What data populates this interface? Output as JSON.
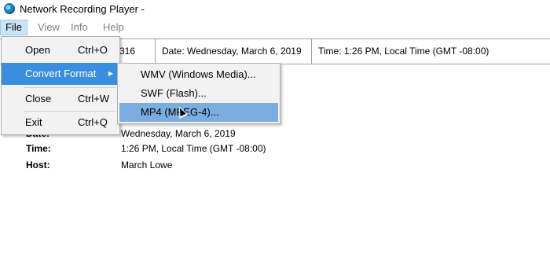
{
  "window": {
    "title": "Network Recording Player -"
  },
  "menubar": {
    "items": [
      {
        "label": "File"
      },
      {
        "label": "View"
      },
      {
        "label": "Info"
      },
      {
        "label": "Help"
      }
    ]
  },
  "infobar": {
    "cells": [
      {
        "text": "316"
      },
      {
        "text": "Date: Wednesday, March 6, 2019"
      },
      {
        "text": "Time: 1:26 PM, Local Time (GMT -08:00)"
      }
    ]
  },
  "details": [
    {
      "label": "Date:",
      "value": "Wednesday, March 6, 2019"
    },
    {
      "label": "Time:",
      "value": "1:26 PM, Local Time (GMT -08:00)"
    },
    {
      "label": "Host:",
      "value": "March Lowe"
    }
  ],
  "file_menu": {
    "items": [
      {
        "label": "Open",
        "shortcut": "Ctrl+O"
      },
      {
        "label": "Convert Format",
        "shortcut": ""
      },
      {
        "label": "Close",
        "shortcut": "Ctrl+W"
      },
      {
        "label": "Exit",
        "shortcut": "Ctrl+Q"
      }
    ]
  },
  "convert_submenu": {
    "items": [
      {
        "label": "WMV (Windows Media)..."
      },
      {
        "label": "SWF (Flash)..."
      },
      {
        "label": "MP4 (MPEG-4)..."
      }
    ]
  },
  "colors": {
    "menu_highlight": "#3a8ee0",
    "submenu_highlight": "#7aaee0",
    "menubar_active": "#cce4f7"
  }
}
